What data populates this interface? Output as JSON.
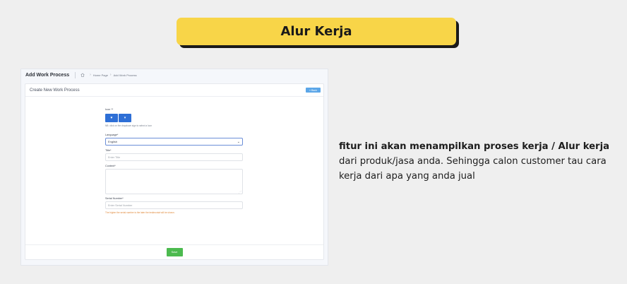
{
  "banner": {
    "title": "Alur Kerja"
  },
  "screenshot": {
    "page_title": "Add Work Process",
    "breadcrumb": [
      "Home Page",
      "Add Work Process"
    ],
    "card_title": "Create New Work Process",
    "back_label": "Back",
    "icon_label": "Icon **",
    "icon_hint": "NB: click on the dropdown sign to select a Icon",
    "language_label": "Language*",
    "language_value": "English",
    "title_label": "Title*",
    "title_placeholder": "Enter Title",
    "content_label": "Content*",
    "serial_label": "Serial Number*",
    "serial_placeholder": "Enter Serial Number",
    "serial_hint": "The higher the serial number is the later the testimonial will be shown.",
    "save_label": "Save",
    "colors": {
      "primary": "#2e6fd6",
      "back": "#5ba6e8",
      "save": "#4cba4f",
      "warning": "#e0893a"
    }
  },
  "description": {
    "bold": "fitur ini akan menampilkan proses kerja / Alur kerja",
    "rest": " dari produk/jasa anda. Sehingga calon customer tau cara kerja dari apa yang anda jual"
  },
  "colors": {
    "banner": "#f8d548",
    "background": "#efefef"
  }
}
